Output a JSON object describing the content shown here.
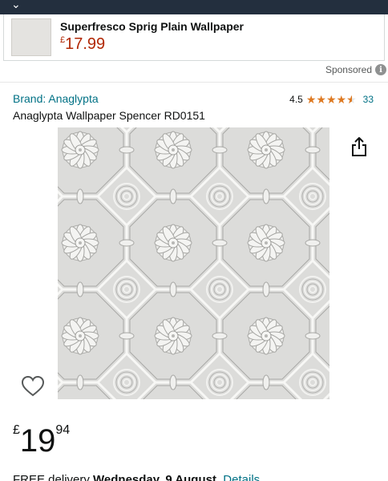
{
  "ad": {
    "title": "Superfresco Sprig Plain Wallpaper",
    "price_currency": "£",
    "price_amount": "17.99"
  },
  "sponsored_label": "Sponsored",
  "product": {
    "brand": "Brand: Anaglypta",
    "rating": "4.5",
    "rating_value": 4.5,
    "rating_max": 5,
    "rating_count": "33",
    "title": "Anaglypta Wallpaper Spencer RD0151",
    "price_currency": "£",
    "price_whole": "19",
    "price_fraction": "94"
  },
  "delivery": {
    "prefix": "FREE delivery",
    "date": "Wednesday, 9 August",
    "details_link": "Details"
  },
  "icons": {
    "back": "chevron-down-icon",
    "info": "info-icon",
    "star": "star-icon",
    "share": "share-icon",
    "wishlist": "heart-icon"
  },
  "colors": {
    "header": "#232f3e",
    "link": "#007185",
    "price_red": "#b12704",
    "star": "#de7921"
  }
}
